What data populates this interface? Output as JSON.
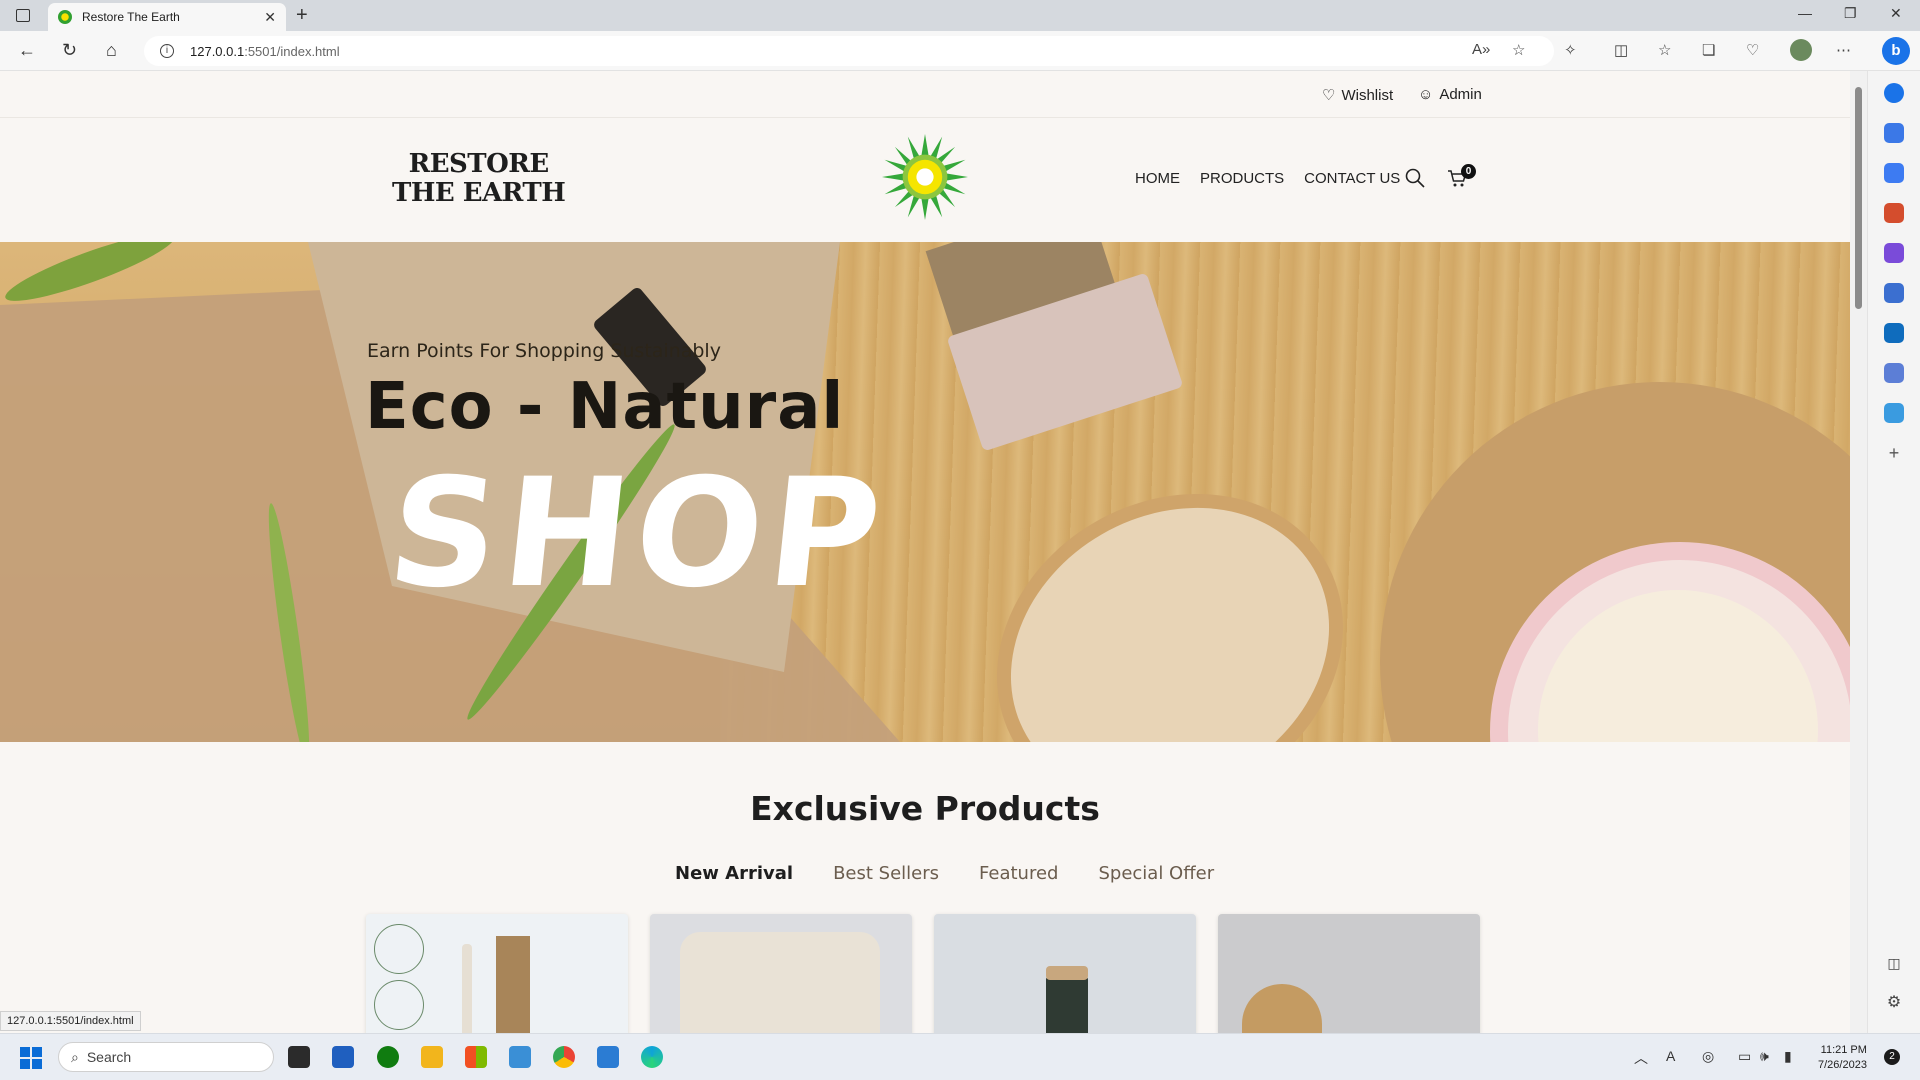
{
  "browser": {
    "tab_title": "Restore The Earth",
    "url_host": "127.0.0.1",
    "url_rest": ":5501/index.html",
    "status_url": "127.0.0.1:5501/index.html",
    "read_aloud": "A»"
  },
  "utility": {
    "wishlist_label": "Wishlist",
    "admin_label": "Admin"
  },
  "header": {
    "logo_line1": "RESTORE",
    "logo_line2": "THE EARTH",
    "menu": [
      "HOME",
      "PRODUCTS",
      "CONTACT US"
    ],
    "cart_count": "0"
  },
  "hero": {
    "subtitle": "Earn Points For Shopping Sustainably",
    "title": "Eco - Natural",
    "big_word": "SHOP"
  },
  "products": {
    "section_title": "Exclusive Products",
    "tabs": [
      "New Arrival",
      "Best Sellers",
      "Featured",
      "Special Offer"
    ]
  },
  "taskbar": {
    "search_placeholder": "Search",
    "time": "11:21 PM",
    "date": "7/26/2023",
    "notification_count": "2"
  },
  "colors": {
    "page_bg": "#f9f6f3",
    "accent_text": "#1e1e1e",
    "tab_inactive": "#6b5d4e"
  }
}
